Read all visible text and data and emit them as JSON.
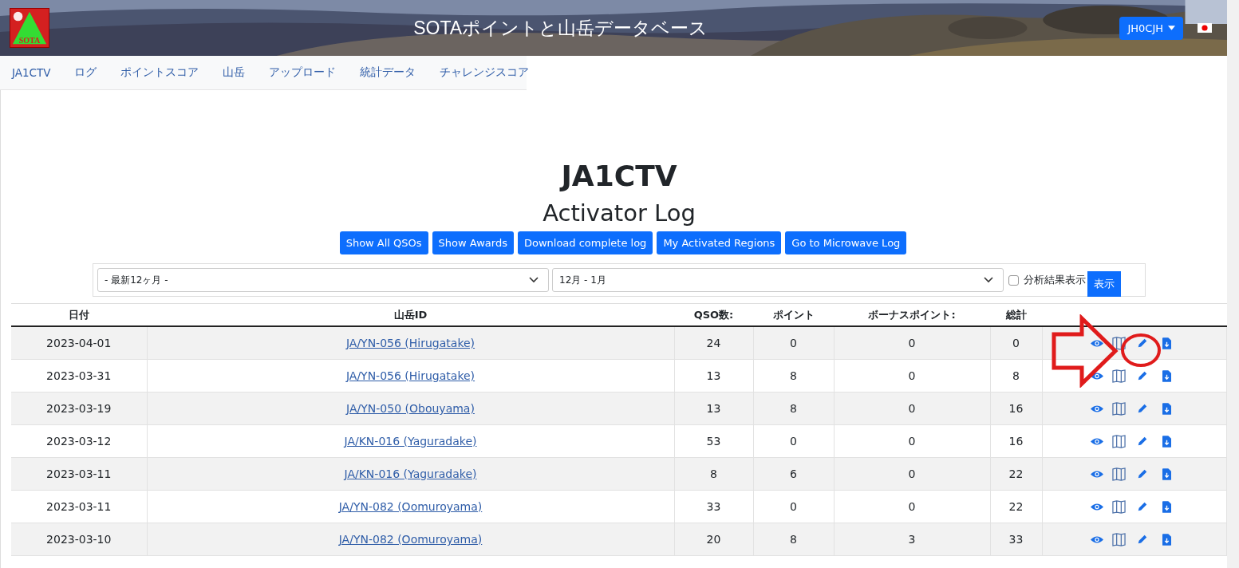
{
  "header": {
    "logo_text": "SOTA",
    "title": "SOTAポイントと山岳データベース",
    "user_button": "JH0CJH"
  },
  "nav": [
    {
      "label": "JA1CTV"
    },
    {
      "label": "ログ"
    },
    {
      "label": "ポイントスコア"
    },
    {
      "label": "山岳"
    },
    {
      "label": "アップロード"
    },
    {
      "label": "統計データ"
    },
    {
      "label": "チャレンジスコア"
    }
  ],
  "page_title": "JA1CTV",
  "page_subtitle": "Activator Log",
  "buttons": [
    "Show All QSOs",
    "Show Awards",
    "Download complete log",
    "My Activated Regions",
    "Go to Microwave Log"
  ],
  "filter": {
    "period": "- 最新12ヶ月 -",
    "months": "12月 - 1月",
    "analysis_label": "分析結果表示",
    "analysis_checked": false,
    "submit": "表示"
  },
  "table": {
    "columns": [
      "日付",
      "山岳ID",
      "QSO数:",
      "ポイント",
      "ボーナスポイント:",
      "総計"
    ],
    "rows": [
      {
        "date": "2023-04-01",
        "summit": "JA/YN-056 (Hirugatake)",
        "qso": "24",
        "points": "0",
        "bonus": "0",
        "total": "0"
      },
      {
        "date": "2023-03-31",
        "summit": "JA/YN-056 (Hirugatake)",
        "qso": "13",
        "points": "8",
        "bonus": "0",
        "total": "8"
      },
      {
        "date": "2023-03-19",
        "summit": "JA/YN-050 (Obouyama)",
        "qso": "13",
        "points": "8",
        "bonus": "0",
        "total": "16"
      },
      {
        "date": "2023-03-12",
        "summit": "JA/KN-016 (Yaguradake)",
        "qso": "53",
        "points": "0",
        "bonus": "0",
        "total": "16"
      },
      {
        "date": "2023-03-11",
        "summit": "JA/KN-016 (Yaguradake)",
        "qso": "8",
        "points": "6",
        "bonus": "0",
        "total": "22"
      },
      {
        "date": "2023-03-11",
        "summit": "JA/YN-082 (Oomuroyama)",
        "qso": "33",
        "points": "0",
        "bonus": "0",
        "total": "22"
      },
      {
        "date": "2023-03-10",
        "summit": "JA/YN-082 (Oomuroyama)",
        "qso": "20",
        "points": "8",
        "bonus": "3",
        "total": "33"
      }
    ]
  },
  "annotations": [
    {
      "kind": "arrow"
    },
    {
      "kind": "circle"
    }
  ]
}
